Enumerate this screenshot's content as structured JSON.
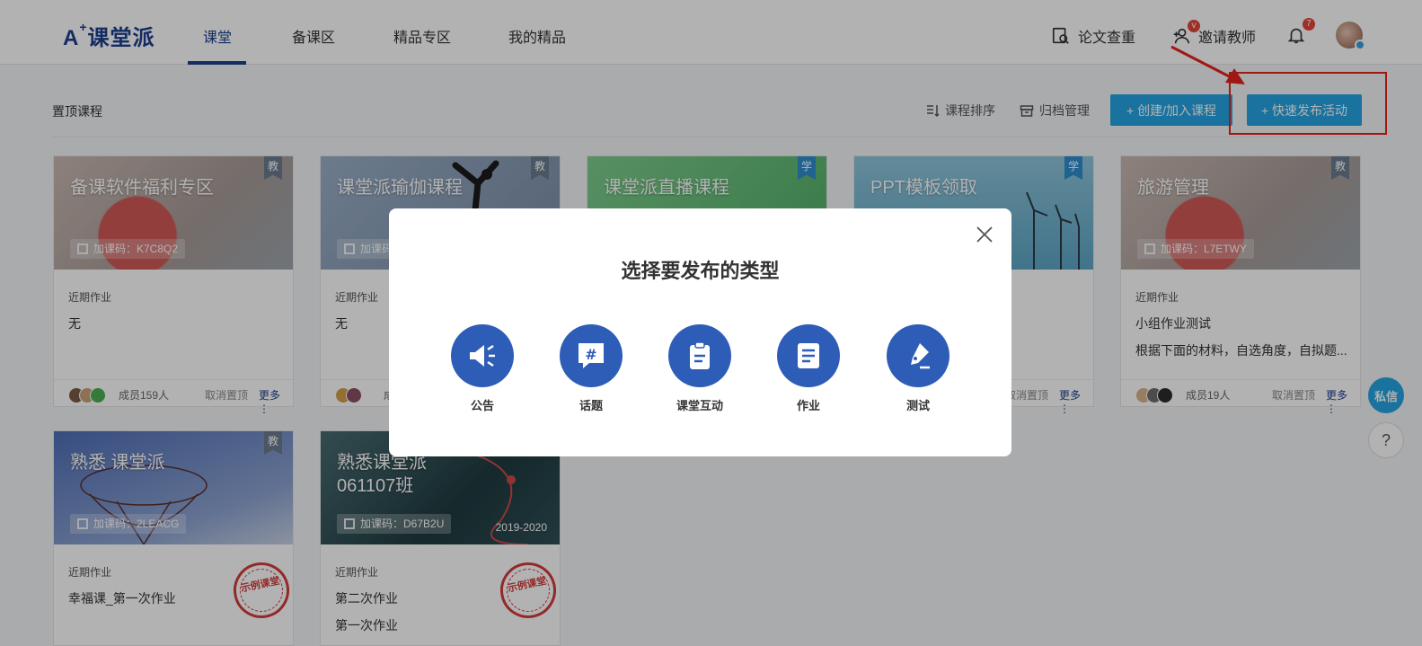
{
  "brand": {
    "logo_text": "课堂派",
    "logo_prefix": "A",
    "logo_sup": "+"
  },
  "nav": {
    "tabs": [
      {
        "label": "课堂"
      },
      {
        "label": "备课区"
      },
      {
        "label": "精品专区"
      },
      {
        "label": "我的精品"
      }
    ],
    "plagiarism_label": "论文查重",
    "invite_label": "邀请教师",
    "invite_badge": "v",
    "notify_count": "7"
  },
  "toolbar": {
    "section_title": "置顶课程",
    "sort_label": "课程排序",
    "archive_label": "归档管理",
    "create_join_label": "+ 创建/加入课程",
    "quick_publish_label": "+ 快速发布活动"
  },
  "cards": [
    {
      "title": "备课软件福利专区",
      "code": "加课码：K7C8Q2",
      "tag": "教",
      "hw_label": "近期作业",
      "hw_items": [
        "无"
      ],
      "members": "成员159人",
      "unpin": "取消置顶",
      "more": "更多 ⋮"
    },
    {
      "title": "课堂派瑜伽课程",
      "code": "加课码",
      "tag": "教",
      "hw_label": "近期作业",
      "hw_items": [
        "无"
      ],
      "members": "成",
      "unpin": "",
      "more": ""
    },
    {
      "title": "课堂派直播课程",
      "code": "",
      "tag": "学",
      "hw_label": "",
      "hw_items": [],
      "members": "",
      "unpin": "",
      "more": ""
    },
    {
      "title": "PPT模板领取",
      "code": "",
      "tag": "学",
      "hw_label": "",
      "hw_items": [],
      "members": "",
      "unpin": "取消置顶",
      "more": "更多 ⋮"
    },
    {
      "title": "旅游管理",
      "code": "加课码：L7ETWY",
      "tag": "教",
      "hw_label": "近期作业",
      "hw_items": [
        "小组作业测试",
        "根据下面的材料，自选角度，自拟题..."
      ],
      "members": "成员19人",
      "unpin": "取消置顶",
      "more": "更多 ⋮"
    },
    {
      "title": "熟悉 课堂派",
      "code": "加课码：2LEACG",
      "tag": "教",
      "hw_label": "近期作业",
      "hw_items": [
        "幸福课_第一次作业"
      ],
      "members": "",
      "unpin": "",
      "more": "",
      "stamp": "示例课堂"
    },
    {
      "title": "熟悉课堂派\n061107班",
      "code": "加课码：D67B2U",
      "tag": "",
      "year": "2019-2020",
      "hw_label": "近期作业",
      "hw_items": [
        "第二次作业",
        "第一次作业"
      ],
      "members": "",
      "unpin": "",
      "more": "",
      "stamp": "示例课堂"
    }
  ],
  "modal": {
    "title": "选择要发布的类型",
    "types": [
      {
        "label": "公告",
        "icon": "megaphone-icon"
      },
      {
        "label": "话题",
        "icon": "topic-hash-icon"
      },
      {
        "label": "课堂互动",
        "icon": "clipboard-icon"
      },
      {
        "label": "作业",
        "icon": "document-icon"
      },
      {
        "label": "测试",
        "icon": "pen-nib-icon"
      }
    ]
  },
  "float": {
    "chat_label": "私信",
    "help_label": "?"
  },
  "colors": {
    "brand_blue": "#1d3f8f",
    "accent_blue": "#24a5e3",
    "modal_icon_blue": "#2d5db6",
    "highlight_red": "#e5231d"
  }
}
